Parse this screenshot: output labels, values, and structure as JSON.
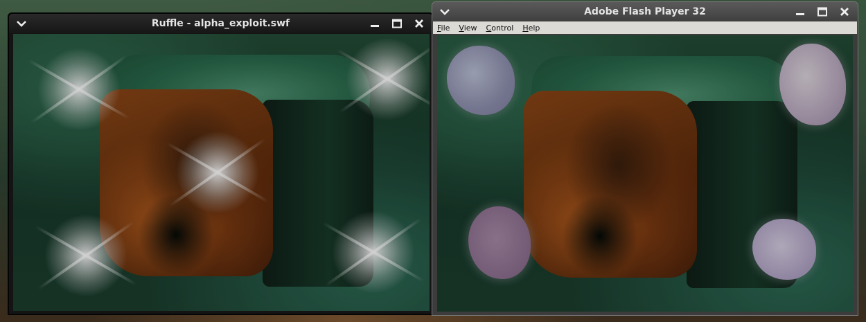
{
  "windows": {
    "ruffle": {
      "title": "Ruffle - alpha_exploit.swf"
    },
    "flash": {
      "title": "Adobe Flash Player 32",
      "menu": [
        "File",
        "View",
        "Control",
        "Help"
      ]
    }
  },
  "icons": {
    "window_menu": "chevron-down-icon",
    "minimize": "minimize-icon",
    "maximize": "maximize-icon",
    "close": "close-icon"
  },
  "colors": {
    "titlebar_dark": "#161616",
    "titlebar_gray": "#4a4a4a",
    "menubar": "#dcdad5"
  }
}
